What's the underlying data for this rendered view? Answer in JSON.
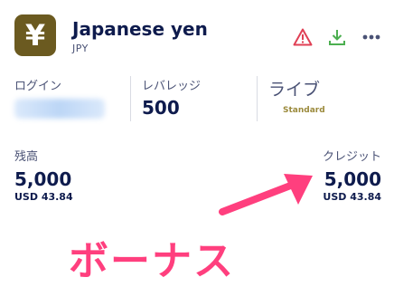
{
  "account": {
    "currency_symbol": "¥",
    "name": "Japanese yen",
    "code": "JPY"
  },
  "icons": {
    "warning": "warning-icon",
    "download": "download-icon",
    "more": "more-icon"
  },
  "stats": {
    "login_label": "ログイン",
    "leverage_label": "レバレッジ",
    "leverage_value": "500",
    "mode_label": "ライブ",
    "mode_badge": "Standard"
  },
  "balance": {
    "label": "残高",
    "value": "5,000",
    "usd": "USD 43.84"
  },
  "credit": {
    "label": "クレジット",
    "value": "5,000",
    "usd": "USD 43.84"
  },
  "annotation": {
    "text": "ボーナス"
  },
  "colors": {
    "brand_icon_bg": "#6b5a20",
    "warning": "#e04055",
    "download": "#4caf50",
    "annotation": "#ff3f7e",
    "text_primary": "#0e1b4d",
    "badge": "#9b8a3c"
  }
}
